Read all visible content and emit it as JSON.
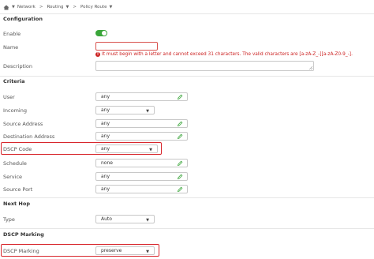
{
  "breadcrumb": {
    "network": "Network",
    "routing": "Routing",
    "policy_route": "Policy Route",
    "separator": ">"
  },
  "configuration": {
    "title": "Configuration",
    "enable_label": "Enable",
    "enable_state": "on",
    "name_label": "Name",
    "name_value": "",
    "name_error": "It must begin with a letter and cannot exceed 31 characters. The valid characters are [a-zA-Z_-][a-zA-Z0-9_-].",
    "description_label": "Description",
    "description_value": ""
  },
  "criteria": {
    "title": "Criteria",
    "user_label": "User",
    "user_value": "any",
    "incoming_label": "Incoming",
    "incoming_value": "any",
    "source_address_label": "Source Address",
    "source_address_value": "any",
    "destination_address_label": "Destination Address",
    "destination_address_value": "any",
    "dscp_code_label": "DSCP Code",
    "dscp_code_value": "any",
    "schedule_label": "Schedule",
    "schedule_value": "none",
    "service_label": "Service",
    "service_value": "any",
    "source_port_label": "Source Port",
    "source_port_value": "any"
  },
  "next_hop": {
    "title": "Next Hop",
    "type_label": "Type",
    "type_value": "Auto"
  },
  "dscp_marking": {
    "title": "DSCP Marking",
    "marking_label": "DSCP Marking",
    "marking_value": "preserve"
  },
  "colors": {
    "toggle_on": "#3aa63a",
    "edit_icon": "#3aa63a",
    "error": "#cc2222",
    "highlight": "#d8262c"
  },
  "icons": {
    "home": "home-icon",
    "edit": "pencil-icon",
    "dropdown": "chevron-down-icon",
    "error": "error-icon"
  }
}
